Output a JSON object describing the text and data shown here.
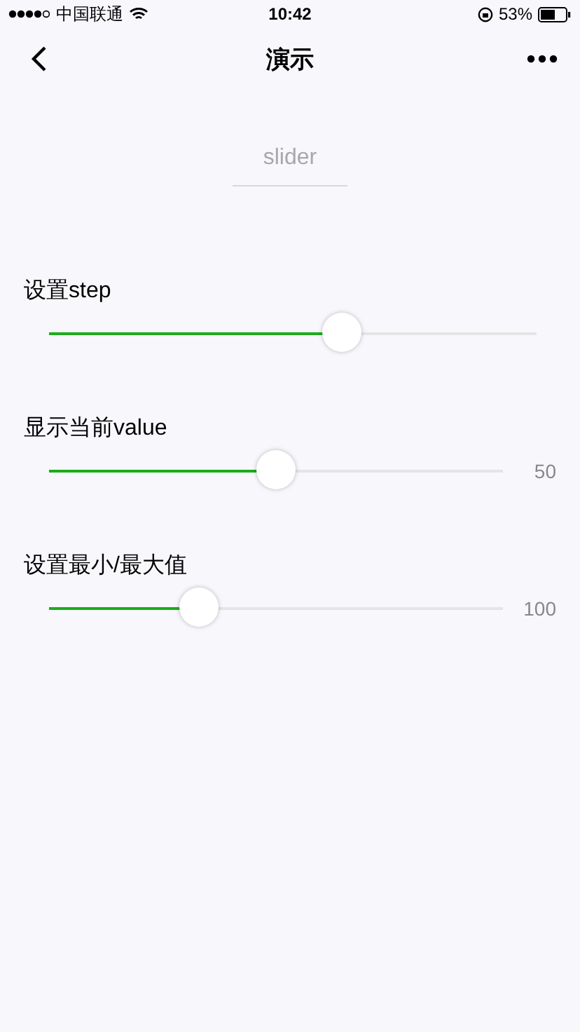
{
  "status_bar": {
    "carrier": "中国联通",
    "time": "10:42",
    "battery": "53%"
  },
  "nav": {
    "title": "演示"
  },
  "header": {
    "title": "slider"
  },
  "sliders": [
    {
      "label": "设置step",
      "level": 0.6
    },
    {
      "label": "显示当前value",
      "level": 0.5,
      "value": "50"
    },
    {
      "label": "设置最小/最大值",
      "level": 0.33,
      "value": "100"
    }
  ]
}
